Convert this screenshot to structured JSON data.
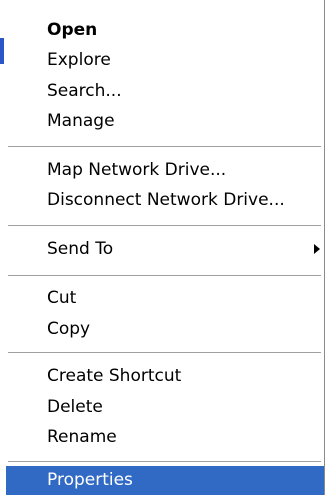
{
  "menu": {
    "open": "Open",
    "explore": "Explore",
    "search": "Search...",
    "manage": "Manage",
    "map_drive": "Map Network Drive...",
    "disconnect_drive": "Disconnect Network Drive...",
    "send_to": "Send To",
    "cut": "Cut",
    "copy": "Copy",
    "create_shortcut": "Create Shortcut",
    "delete": "Delete",
    "rename": "Rename",
    "properties": "Properties"
  },
  "icons": {
    "submenu": "submenu-arrow-icon"
  },
  "colors": {
    "highlight": "#316ac5",
    "separator": "#a0a0a0",
    "edge_mark": "#2b56c8"
  }
}
